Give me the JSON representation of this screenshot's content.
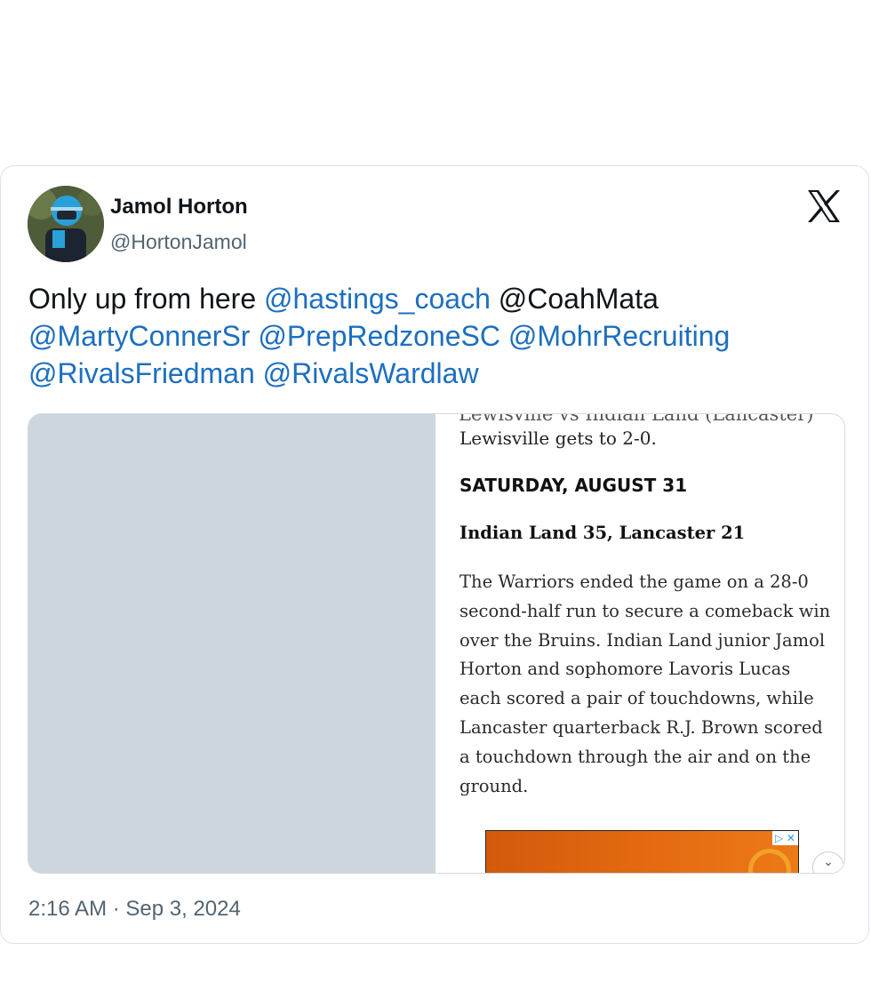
{
  "tweet": {
    "display_name": "Jamol Horton",
    "handle": "@HortonJamol",
    "text_plain_1": "Only up from here",
    "mentions": [
      "@hastings_coach",
      "@CoahMata",
      "@MartyConnerSr",
      "@PrepRedzoneSC",
      "@MohrRecruiting",
      "@RivalsFriedman",
      "@RivalsWardlaw"
    ],
    "timestamp": "2:16 AM · Sep 3, 2024"
  },
  "media": {
    "cut_top_line": "Lewisville vs Indian Land (Lancaster)",
    "paragraph_1": "Lewisville gets to 2-0.",
    "heading": "SATURDAY, AUGUST 31",
    "subheading": "Indian Land 35, Lancaster 21",
    "body": "The Warriors ended the game on a 28-0 second-half run to secure a comeback win over the Bruins. Indian Land junior Jamol Horton and sophomore Lavoris Lucas each scored a pair of touchdowns, while Lancaster quarterback R.J. Brown scored a touchdown through the air and on the ground.",
    "ad_choices": "▷ ✕",
    "collapse_icon": "⌄"
  },
  "icons": {
    "logo": "x-logo",
    "collapse": "chevron-down-icon"
  },
  "colors": {
    "mention": "#1d6fbf",
    "secondary_text": "#536471",
    "media_placeholder": "#ccd6dc"
  }
}
